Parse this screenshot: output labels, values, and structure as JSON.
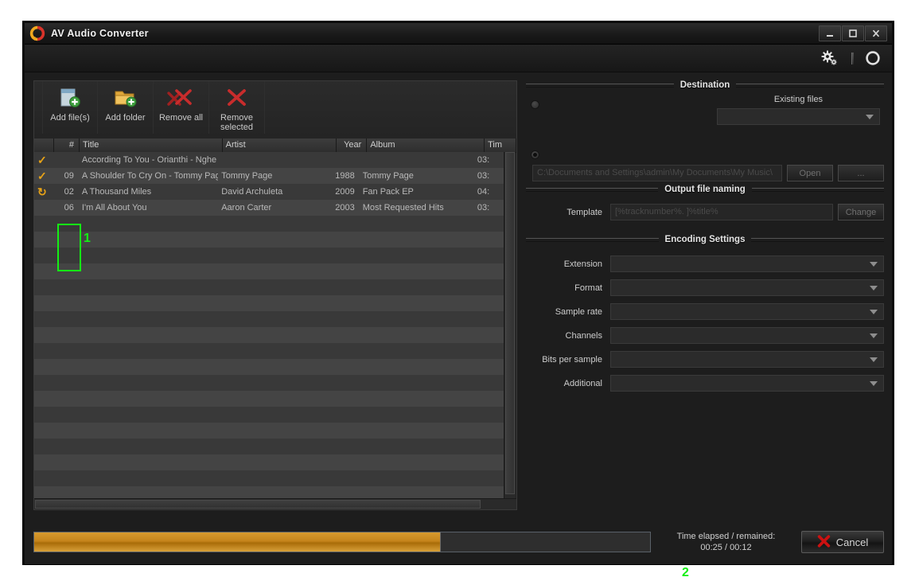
{
  "window": {
    "title": "AV Audio Converter",
    "logo_icon": "recycle-arrows-icon",
    "controls": {
      "minimize": "minimize-icon",
      "maximize": "maximize-icon",
      "close": "close-icon"
    }
  },
  "header": {
    "settings_icon": "gears-icon",
    "about_icon": "circle-icon"
  },
  "toolbar": {
    "buttons": [
      {
        "label": "Add file(s)",
        "icon": "add-file-icon"
      },
      {
        "label": "Add folder",
        "icon": "add-folder-icon"
      },
      {
        "label": "Remove all",
        "icon": "double-red-x-icon"
      },
      {
        "label": "Remove\nselected",
        "label_line1": "Remove",
        "label_line2": "selected",
        "icon": "red-x-icon"
      }
    ]
  },
  "filelist": {
    "columns": [
      "",
      "#",
      "Title",
      "Artist",
      "Year",
      "Album",
      "Tim"
    ],
    "rows": [
      {
        "status": "check",
        "num": "",
        "title": "According To You - Orianthi - Nghe",
        "artist": "",
        "year": "",
        "album": "",
        "time": "03:"
      },
      {
        "status": "check",
        "num": "09",
        "title": "A Shoulder To Cry On - Tommy Pag",
        "artist": "Tommy Page",
        "year": "1988",
        "album": "Tommy Page",
        "time": "03:"
      },
      {
        "status": "spinner",
        "num": "02",
        "title": "A Thousand Miles",
        "artist": "David Archuleta",
        "year": "2009",
        "album": "Fan Pack EP",
        "time": "04:"
      },
      {
        "status": "",
        "num": "06",
        "title": "I'm All About You",
        "artist": "Aaron Carter",
        "year": "2003",
        "album": "Most Requested Hits",
        "time": "03:"
      }
    ],
    "empty_row_count": 19,
    "check_glyph": "✓",
    "spinner_glyph": "↻",
    "status_color": "#e8a317"
  },
  "destination": {
    "title": "Destination",
    "existing_files_label": "Existing files",
    "existing_files_value": "",
    "radio_selected_index": 1,
    "path_value": "C:\\Documents and Settings\\admin\\My Documents\\My Music\\",
    "open_button": "Open",
    "browse_button": "..."
  },
  "output_naming": {
    "title": "Output file naming",
    "template_label": "Template",
    "template_value": "[%tracknumber%. ]%title%",
    "change_button": "Change"
  },
  "encoding": {
    "title": "Encoding Settings",
    "fields": [
      {
        "label": "Extension",
        "value": ""
      },
      {
        "label": "Format",
        "value": ""
      },
      {
        "label": "Sample rate",
        "value": ""
      },
      {
        "label": "Channels",
        "value": ""
      },
      {
        "label": "Bits per sample",
        "value": ""
      },
      {
        "label": "Additional",
        "value": ""
      }
    ]
  },
  "footer": {
    "progress_percent": 66,
    "progress_color": "#c5841c",
    "time_label": "Time elapsed / remained:",
    "time_value": "00:25 / 00:12",
    "cancel_label": "Cancel",
    "cancel_icon": "red-x-icon"
  },
  "annotations": [
    {
      "id": "1",
      "label": "1",
      "color": "#14ef14"
    },
    {
      "id": "2",
      "label": "2",
      "color": "#14ef14"
    }
  ]
}
